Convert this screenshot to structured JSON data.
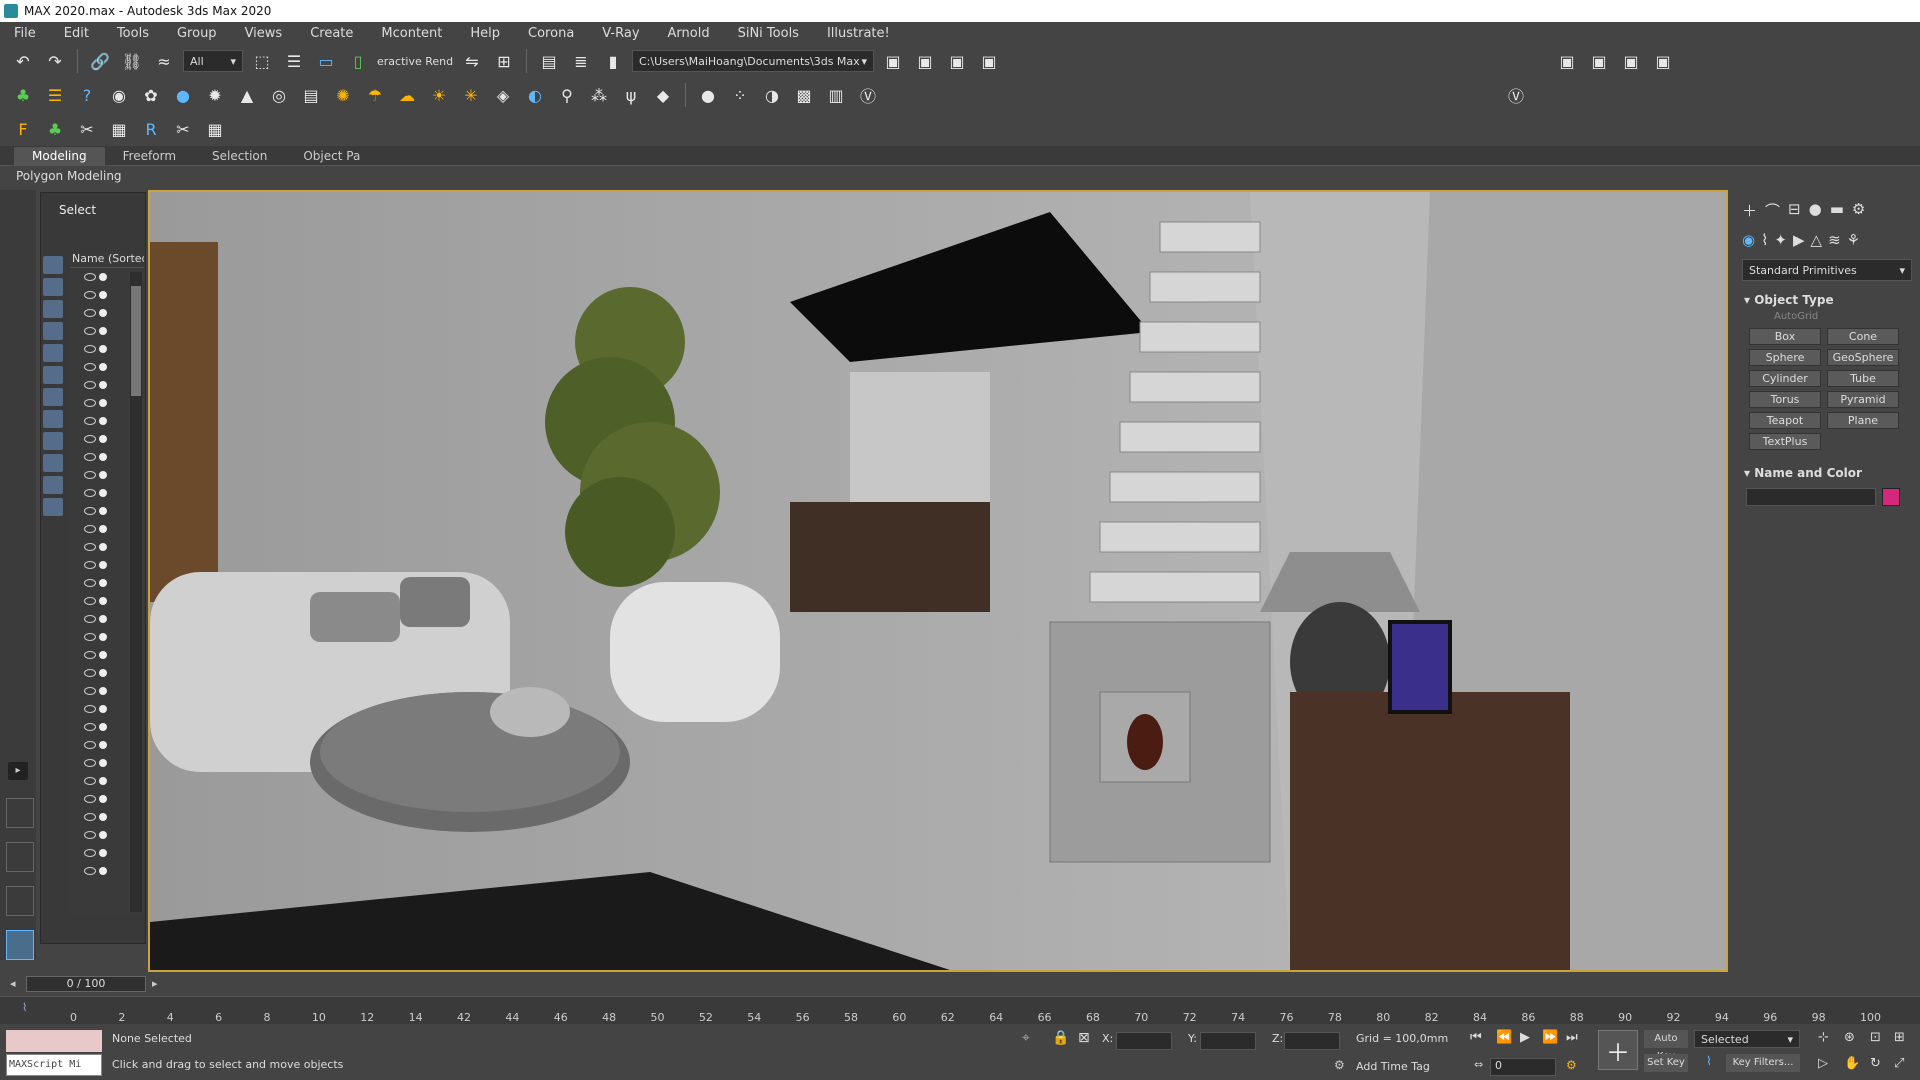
{
  "window": {
    "title": "MAX 2020.max - Autodesk 3ds Max 2020"
  },
  "menu": [
    "File",
    "Edit",
    "Tools",
    "Group",
    "Views",
    "Create",
    "Mcontent",
    "Help",
    "Corona",
    "V-Ray",
    "Arnold",
    "SiNi Tools",
    "Illustrate!"
  ],
  "toolbar": {
    "selection_filter": "All",
    "render_label": "eractive Rend",
    "project_path": "C:\\Users\\MaiHoang\\Documents\\3ds Max 2020"
  },
  "ribbon": {
    "tabs": [
      "Modeling",
      "Freeform",
      "Selection",
      "Object Pa"
    ],
    "active": "Modeling",
    "subtitle": "Polygon Modeling"
  },
  "scene_explorer": {
    "select_label": "Select",
    "column_header": "Name (Sorted A"
  },
  "command_panel": {
    "category": "Standard Primitives",
    "object_type_title": "Object Type",
    "autogrid_label": "AutoGrid",
    "buttons": [
      "Box",
      "Cone",
      "Sphere",
      "GeoSphere",
      "Cylinder",
      "Tube",
      "Torus",
      "Pyramid",
      "Teapot",
      "Plane",
      "TextPlus"
    ],
    "name_color_title": "Name and Color",
    "object_color": "#d6287a"
  },
  "timeline": {
    "frame_display": "0 / 100",
    "ticks": [
      "0",
      "2",
      "4",
      "6",
      "8",
      "10",
      "12",
      "14",
      "42",
      "44",
      "46",
      "48",
      "50",
      "52",
      "54",
      "56",
      "58",
      "60",
      "62",
      "64",
      "66",
      "68",
      "70",
      "72",
      "74",
      "76",
      "78",
      "80",
      "82",
      "84",
      "86",
      "88",
      "90",
      "92",
      "94",
      "96",
      "98",
      "100"
    ]
  },
  "status": {
    "selection_status": "None Selected",
    "prompt": "Click and drag to select and move objects",
    "maxscript_label": "MAXScript Mi",
    "x_label": "X:",
    "y_label": "Y:",
    "z_label": "Z:",
    "grid": "Grid = 100,0mm",
    "add_time_tag": "Add Time Tag",
    "auto_key": "Auto Key",
    "set_key": "Set Key",
    "key_mode": "Selected",
    "key_filters": "Key Filters...",
    "current_frame": "0"
  },
  "colors": {
    "viewport_border": "#c9a33c",
    "ui_bg": "#444444",
    "accent": "#5fb8ff"
  }
}
